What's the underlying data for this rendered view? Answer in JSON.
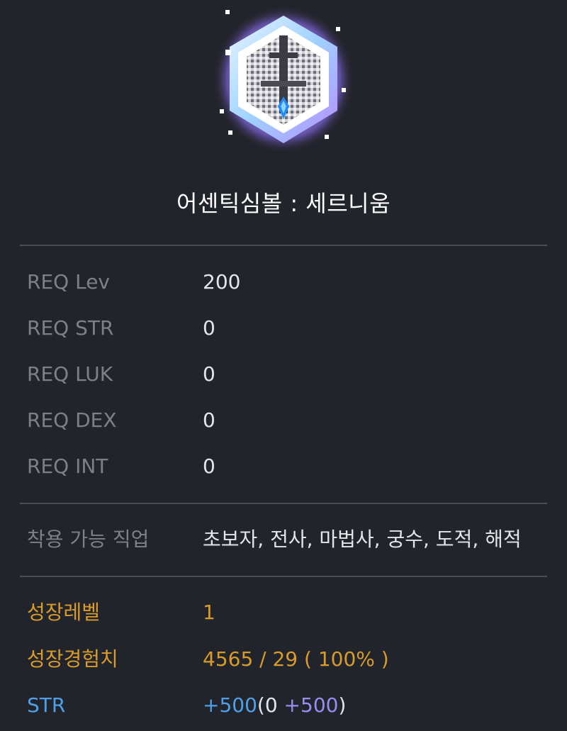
{
  "item": {
    "name": "어센틱심볼 : 세르니움",
    "icon": "authentic-symbol-cernium-icon"
  },
  "requirements": [
    {
      "label": "REQ Lev",
      "value": "200"
    },
    {
      "label": "REQ STR",
      "value": "0"
    },
    {
      "label": "REQ LUK",
      "value": "0"
    },
    {
      "label": "REQ DEX",
      "value": "0"
    },
    {
      "label": "REQ INT",
      "value": "0"
    }
  ],
  "job": {
    "label": "착용 가능 직업",
    "value": "초보자, 전사, 마법사, 궁수, 도적, 해적"
  },
  "growth": {
    "level_label": "성장레벨",
    "level_value": "1",
    "exp_label": "성장경험치",
    "exp_value": "4565 / 29 ( 100% )"
  },
  "stat": {
    "label": "STR",
    "total": "+500",
    "open_base": "(0 ",
    "bonus": "+500",
    "close": ")"
  },
  "colors": {
    "background": "#22242b",
    "gold": "#d99c2a",
    "blue": "#4fa0e8",
    "purple": "#9a8cf0"
  }
}
